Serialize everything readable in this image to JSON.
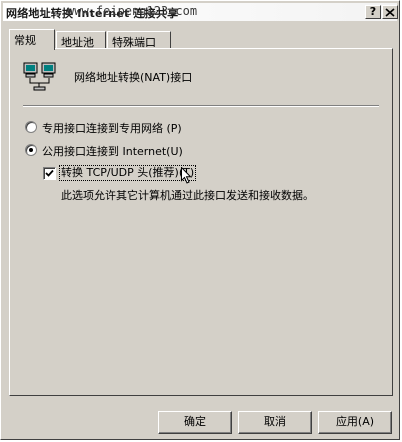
{
  "window": {
    "title": "网络地址转换 Internet 连接共享",
    "watermark": "www.feipeng123.com",
    "help_button": "?",
    "close_button": "X"
  },
  "tabs": [
    {
      "label": "常规",
      "active": true
    },
    {
      "label": "地址池",
      "active": false
    },
    {
      "label": "特殊端口",
      "active": false
    }
  ],
  "general": {
    "icon": "network-computers-icon",
    "nat_label": "网络地址转换(NAT)接口",
    "radio_private": {
      "label": "专用接口连接到专用网络 (P)",
      "selected": false
    },
    "radio_public": {
      "label": "公用接口连接到 Internet(U)",
      "selected": true
    },
    "checkbox": {
      "label": "转换 TCP/UDP 头(推荐)(T)",
      "checked": true
    },
    "description": "此选项允许其它计算机通过此接口发送和接收数据。"
  },
  "buttons": {
    "ok": "确定",
    "cancel": "取消",
    "apply": "应用(A)"
  }
}
